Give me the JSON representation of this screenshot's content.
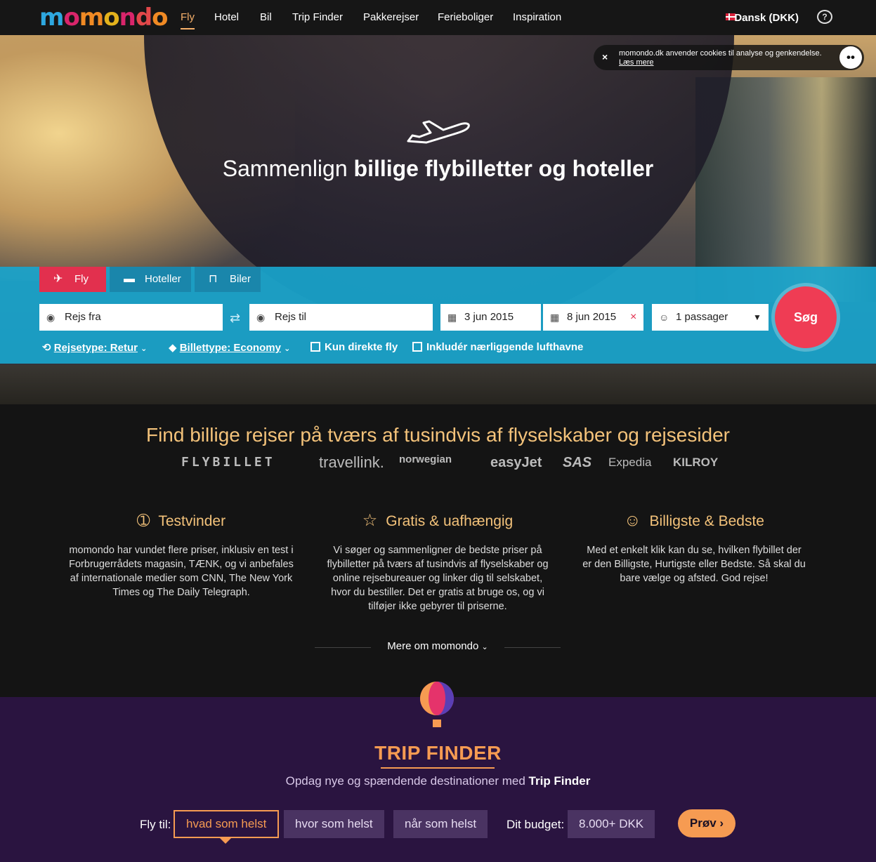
{
  "nav": {
    "logo": "momondo",
    "items": [
      "Fly",
      "Hotel",
      "Bil",
      "Trip Finder",
      "Pakkerejser",
      "Ferieboliger",
      "Inspiration"
    ],
    "language": "Dansk (DKK)"
  },
  "cookie": {
    "text": "momondo.dk anvender cookies til analyse og genkendelse.",
    "link": "Læs mere",
    "close": "×"
  },
  "hero": {
    "title_light": "Sammenlign ",
    "title_bold": "billige flybilletter og hoteller"
  },
  "search": {
    "tabs": [
      "Fly",
      "Hoteller",
      "Biler"
    ],
    "from_placeholder": "Rejs fra",
    "to_placeholder": "Rejs til",
    "depart": "3 jun 2015",
    "return": "8 jun 2015",
    "passengers": "1 passager",
    "submit": "Søg",
    "trip_type": "Rejsetype: Retur",
    "ticket_type": "Billettype: Economy",
    "direct_only": "Kun direkte fly",
    "nearby_airports": "Inkludér nærliggende lufthavne"
  },
  "find": {
    "title": "Find billige rejser på tværs af tusindvis af flyselskaber og rejsesider",
    "brands": [
      "FLYBILLET",
      "travellink.",
      "norwegian",
      "easyJet",
      "SAS",
      "Expedia",
      "KILROY"
    ]
  },
  "features": [
    {
      "title": "Testvinder",
      "icon": "award-icon",
      "text": "momondo har vundet flere priser, inklusiv en test i Forbrugerrådets magasin, TÆNK, og vi anbefales af internationale medier som CNN, The New York Times og The Daily Telegraph."
    },
    {
      "title": "Gratis & uafhængig",
      "icon": "star-icon",
      "text": "Vi søger og sammenligner de bedste priser på flybilletter på tværs af tusindvis af flyselskaber og online rejsebureauer og linker dig til selskabet, hvor du bestiller. Det er gratis at bruge os, og vi tilføjer ikke gebyrer til priserne."
    },
    {
      "title": "Billigste & Bedste",
      "icon": "smiley-icon",
      "text": "Med et enkelt klik kan du se, hvilken flybillet der er den Billigste, Hurtigste eller Bedste. Så skal du bare vælge og afsted. God rejse!"
    }
  ],
  "more": "Mere om momondo",
  "tripfinder": {
    "title": "TRIP FINDER",
    "subtitle_pre": "Opdag nye og spændende destinationer med ",
    "subtitle_bold": "Trip Finder",
    "fly_label": "Fly til:",
    "what": "hvad som helst",
    "where": "hvor som helst",
    "when": "når som helst",
    "budget_label": "Dit budget:",
    "budget": "8.000+ DKK",
    "try": "Prøv"
  },
  "colors": {
    "accent_orange": "#f69b52",
    "search_blue": "#19a5cd",
    "fly_red": "#e2304e",
    "tripfinder_bg": "#2a1440"
  }
}
